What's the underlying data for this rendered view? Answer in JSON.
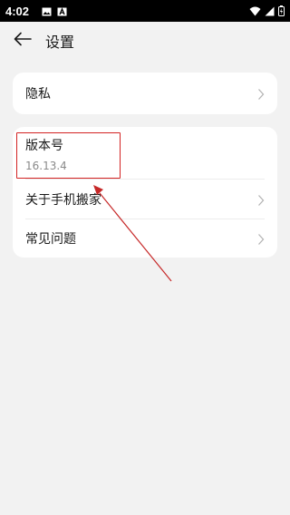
{
  "status_bar": {
    "time": "4:02",
    "left_icons": [
      "image-icon",
      "a-icon"
    ],
    "right_icons": [
      "wifi-icon",
      "signal-icon",
      "battery-icon"
    ]
  },
  "header": {
    "title": "设置",
    "back_icon": "back-arrow-icon"
  },
  "privacy": {
    "label": "隐私"
  },
  "version": {
    "label": "版本号",
    "value": "16.13.4"
  },
  "about": {
    "label": "关于手机搬家"
  },
  "faq": {
    "label": "常见问题"
  },
  "colors": {
    "background": "#f2f2f2",
    "card": "#ffffff",
    "annotation": "#d32222",
    "secondary_text": "#8a8a8a"
  }
}
